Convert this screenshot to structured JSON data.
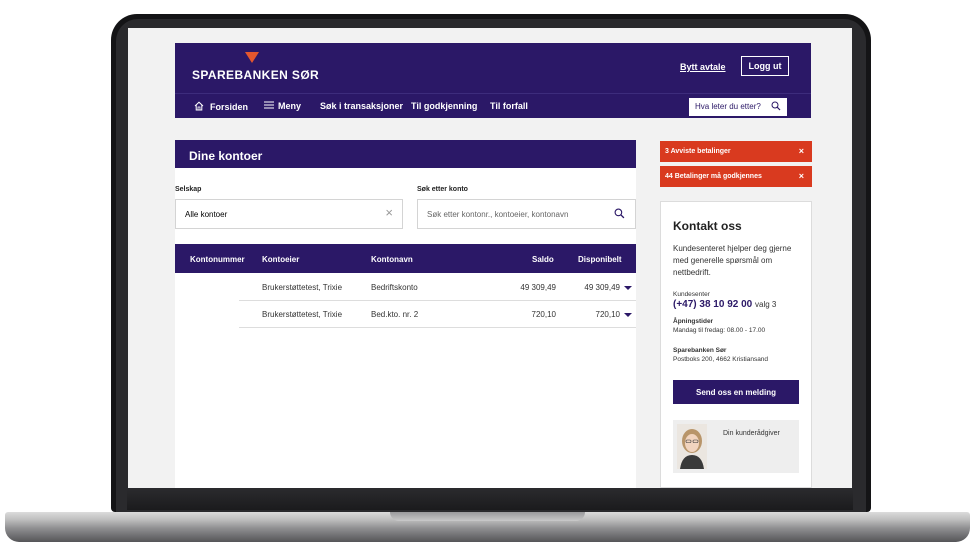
{
  "header": {
    "logo_text": "SPAREBANKEN SØR",
    "bytt_avtale": "Bytt avtale",
    "logg_ut": "Logg ut"
  },
  "nav": {
    "items": [
      "Forsiden",
      "Meny",
      "Søk i transaksjoner",
      "Til godkjenning",
      "Til forfall"
    ],
    "search_placeholder": "Hva leter du etter?"
  },
  "main": {
    "title": "Dine kontoer",
    "selskap_label": "Selskap",
    "selskap_value": "Alle kontoer",
    "search_label": "Søk etter konto",
    "search_placeholder": "Søk etter kontonr., kontoeier, kontonavn",
    "table": {
      "headers": [
        "Kontonummer",
        "Kontoeier",
        "Kontonavn",
        "Saldo",
        "Disponibelt"
      ],
      "rows": [
        {
          "kontonummer": "",
          "kontoeier": "Brukerstøttetest, Trixie",
          "kontonavn": "Bedriftskonto",
          "saldo": "49 309,49",
          "disponibelt": "49 309,49"
        },
        {
          "kontonummer": "",
          "kontoeier": "Brukerstøttetest, Trixie",
          "kontonavn": "Bed.kto. nr. 2",
          "saldo": "720,10",
          "disponibelt": "720,10"
        }
      ]
    }
  },
  "alerts": [
    {
      "text": "3 Avviste betalinger",
      "close": "×"
    },
    {
      "text": "44 Betalinger må godkjennes",
      "close": "×"
    }
  ],
  "contact": {
    "title": "Kontakt oss",
    "intro": "Kundesenteret hjelper deg gjerne med generelle spørsmål om nettbedrift.",
    "kundesenter_label": "Kundesenter",
    "phone": "(+47) 38 10 92 00",
    "phone_suffix": "valg 3",
    "hours_label": "Åpningstider",
    "hours": "Mandag til fredag: 08.00 - 17.00",
    "address_name": "Sparebanken Sør",
    "address": "Postboks 200, 4662 Kristiansand",
    "send_button": "Send oss en melding",
    "advisor_label": "Din kunderådgiver"
  },
  "colors": {
    "brand_purple": "#2b1867",
    "alert_red": "#d93a1f",
    "logo_orange": "#e4572e"
  }
}
